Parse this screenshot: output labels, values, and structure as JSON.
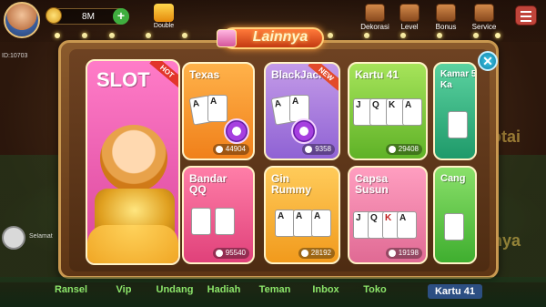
{
  "header": {
    "coins": "8M",
    "user_id": "ID:10703",
    "double_label": "Double",
    "icons": [
      {
        "label": "Dekorasi",
        "icon": "decor-icon"
      },
      {
        "label": "Level",
        "icon": "level-icon"
      },
      {
        "label": "Bonus",
        "icon": "bonus-icon"
      },
      {
        "label": "Service",
        "icon": "service-icon"
      }
    ]
  },
  "panel": {
    "title": "Lainnya"
  },
  "games": {
    "slot": {
      "label": "SLOT",
      "badge": "HOT"
    },
    "texas": {
      "label": "Texas",
      "players": "44904"
    },
    "blackjack": {
      "label": "BlackJack",
      "badge": "NEW",
      "players": "9358"
    },
    "kartu41": {
      "label": "Kartu 41",
      "players": "29408"
    },
    "kamar5": {
      "label": "Kamar 5 Ka"
    },
    "bandarqq": {
      "label": "Bandar QQ",
      "players": "95540"
    },
    "ginrummy": {
      "label": "Gin Rummy",
      "players": "28192"
    },
    "capsasusun": {
      "label": "Capsa Susun",
      "players": "19198"
    },
    "ceme": {
      "label": "Cang"
    }
  },
  "side": {
    "chat_text": "Selamat"
  },
  "background": {
    "deco_right_top": "otai",
    "deco_right_bottom": "inya"
  },
  "bottom_nav": {
    "items": [
      "Ransel",
      "Vip",
      "Undang",
      "Hadiah",
      "Teman",
      "Inbox",
      "Toko"
    ],
    "kartu41": "Kartu 41"
  }
}
